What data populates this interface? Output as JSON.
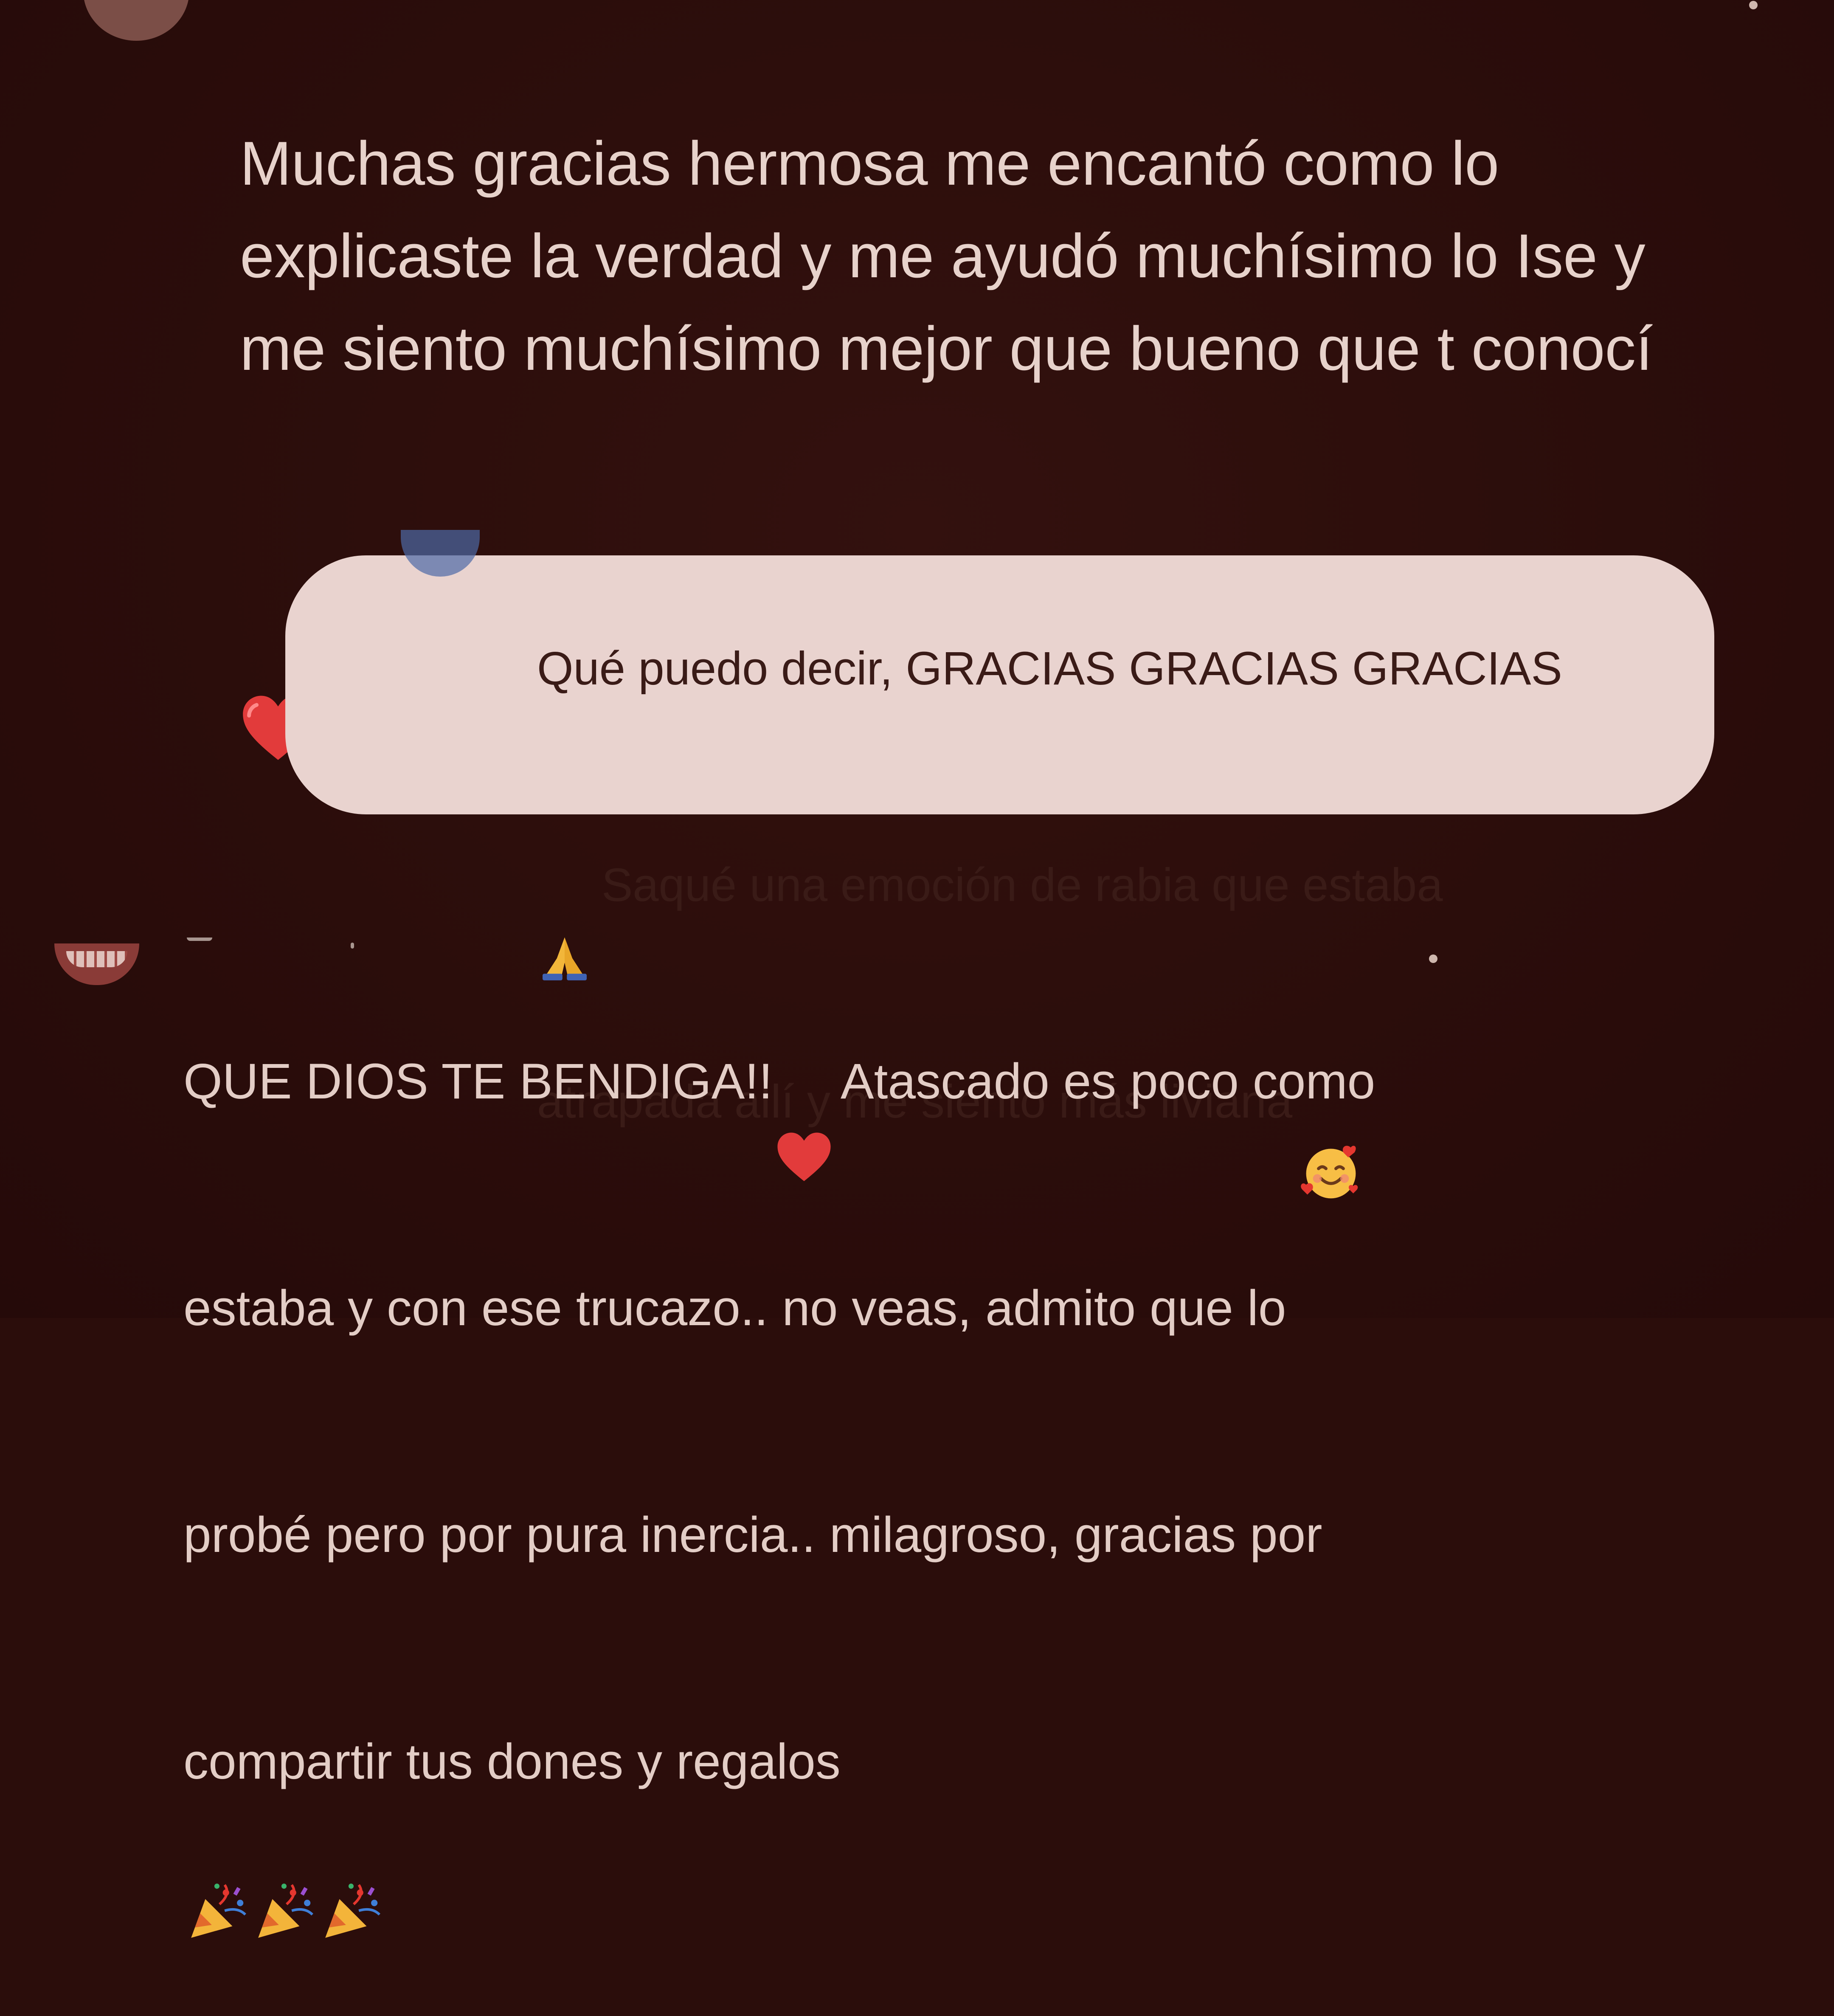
{
  "comments": [
    {
      "text": "Muchas gracias hermosa me encantó como lo\nexplicaste la verdad y me ayudó muchísimo lo Ise y\nme siento muchísimo mejor que bueno que t conocí",
      "emoji": "red-heart"
    },
    {
      "line1": "Qué puedo decir, GRACIAS GRACIAS GRACIAS",
      "line2_emoji": "folded-hands",
      "line2": "Saqué una emoción de rabia que estaba",
      "line3": "atrapada allí y me siento más liviana",
      "line3_emoji": "smiling-face-with-hearts",
      "highlight_color": "#e9d3cf"
    },
    {
      "line1a": "QUE DIOS TE BENDIGA!!",
      "line1_emoji": "red-heart",
      "line1b": "Atascado es poco como",
      "line2": "estaba y con ese trucazo.. no veas, admito que lo",
      "line3": "probé pero por pura inercia.. milagroso, gracias por",
      "line4": "compartir tus dones y regalos",
      "line4_emoji": "party-popper",
      "line4_emoji_count": 3
    }
  ],
  "colors": {
    "background": "#2b0d0b",
    "text": "#e7d2cb",
    "highlight": "#e9d3cf",
    "highlight_text": "#3a1b17",
    "heart": "#e23b3b"
  }
}
